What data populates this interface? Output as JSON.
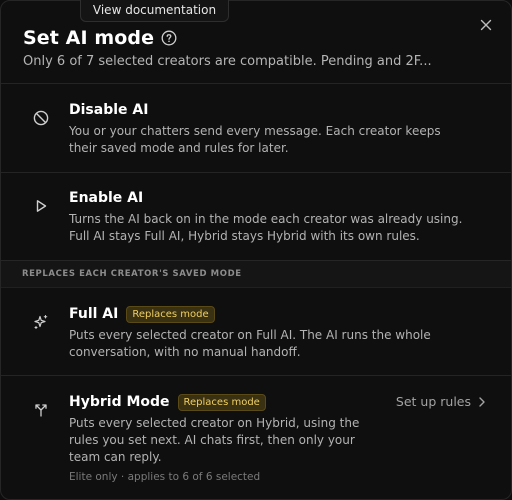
{
  "tooltip": {
    "text": "View documentation"
  },
  "header": {
    "title": "Set AI mode",
    "subtitle": "Only 6 of 7 selected creators are compatible. Pending and 2F..."
  },
  "options": [
    {
      "title": "Disable AI",
      "icon": "ban-icon",
      "description": "You or your chatters send every message. Each creator keeps their saved mode and rules for later."
    },
    {
      "title": "Enable AI",
      "icon": "play-icon",
      "description": "Turns the AI back on in the mode each creator was already using. Full AI stays Full AI, Hybrid stays Hybrid with its own rules."
    }
  ],
  "section": {
    "label": "REPLACES EACH CREATOR'S SAVED MODE"
  },
  "replace_options": [
    {
      "title": "Full AI",
      "badge": "Replaces mode",
      "icon": "sparkles-icon",
      "description": "Puts every selected creator on Full AI. The AI runs the whole conversation, with no manual handoff."
    },
    {
      "title": "Hybrid Mode",
      "badge": "Replaces mode",
      "icon": "split-arrows-icon",
      "description": "Puts every selected creator on Hybrid, using the rules you set next. AI chats first, then only your team can reply.",
      "note": "Elite only · applies to 6 of 6 selected",
      "action": "Set up rules"
    }
  ],
  "colors": {
    "badge_text": "#f0cf62",
    "badge_bg": "#3a3112",
    "background": "#0f0f0f"
  }
}
